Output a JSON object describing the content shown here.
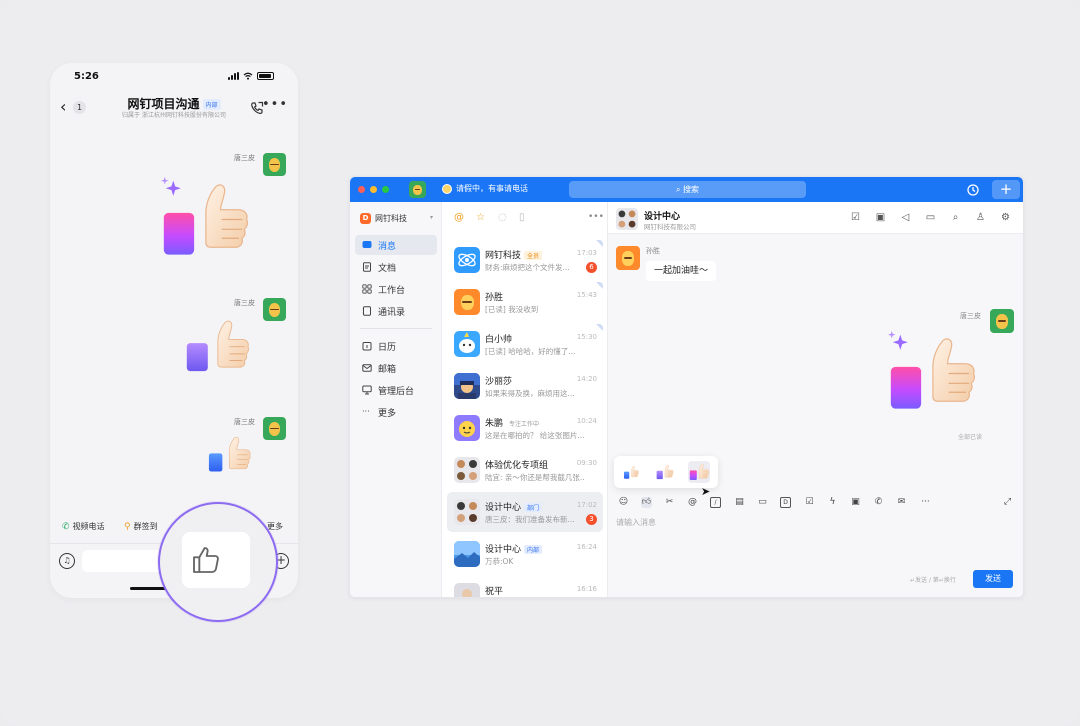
{
  "phone": {
    "time": "5:26",
    "title": "网钉项目沟通",
    "title_tag": "内部",
    "subtitle": "归属于 浙江杭州网钉科技股份有限公司",
    "back_count": "1",
    "messages": [
      {
        "sender": "唐三皮"
      },
      {
        "sender": "唐三皮"
      },
      {
        "sender": "唐三皮"
      }
    ],
    "quick_actions": [
      {
        "label": "视频电话"
      },
      {
        "label": "群签到"
      },
      {
        "label": "更多"
      }
    ]
  },
  "window": {
    "status_text": "请假中，有事请电话",
    "search_placeholder": "搜索",
    "org_name": "网钉科技",
    "org_logo_letter": "D",
    "nav": [
      {
        "label": "消息",
        "icon": "message-icon"
      },
      {
        "label": "文档",
        "icon": "document-icon"
      },
      {
        "label": "工作台",
        "icon": "grid-icon"
      },
      {
        "label": "通讯录",
        "icon": "contacts-icon"
      },
      {
        "label": "日历",
        "icon": "calendar-icon"
      },
      {
        "label": "邮箱",
        "icon": "mail-icon"
      },
      {
        "label": "管理后台",
        "icon": "admin-icon"
      },
      {
        "label": "更多",
        "icon": "more-icon"
      }
    ],
    "conversations": [
      {
        "name": "网钉科技",
        "tag": "全员",
        "preview": "财务:麻烦把这个文件发...",
        "time": "17:03",
        "badge": "6"
      },
      {
        "name": "孙胜",
        "tag": "",
        "preview": "[已读] 我没收到",
        "time": "15:43",
        "badge": ""
      },
      {
        "name": "白小帅",
        "tag": "",
        "preview": "[已读] 哈哈哈，好的懂了...",
        "time": "15:30",
        "badge": ""
      },
      {
        "name": "沙丽莎",
        "tag": "",
        "preview": "如果来得及换，麻烦用这...",
        "time": "14:20",
        "badge": ""
      },
      {
        "name": "朱鹏",
        "tag": "专注工作中",
        "preview": "这是在哪拍的？ 给这张图片...",
        "time": "10:24",
        "badge": ""
      },
      {
        "name": "体验优化专项组",
        "tag": "",
        "preview": "陆宜: 亲～你还是帮我截几张...",
        "time": "09:30",
        "badge": ""
      },
      {
        "name": "设计中心",
        "tag": "部门",
        "preview": "唐三皮：我们准备发布新...",
        "time": "17:02",
        "badge": "3"
      },
      {
        "name": "设计中心",
        "tag": "内部",
        "preview": "万恭:OK",
        "time": "16:24",
        "badge": ""
      },
      {
        "name": "祝平",
        "tag": "",
        "preview": "",
        "time": "16:16",
        "badge": ""
      }
    ],
    "chat": {
      "title": "设计中心",
      "subtitle": "网钉科技有限公司",
      "incoming_sender": "孙胜",
      "incoming_text": "一起加油哇～",
      "outgoing_sender": "唐三皮",
      "read_status": "全部已读",
      "input_placeholder": "请输入消息",
      "send_hint": "↵发送 / 第↵换行",
      "send_label": "发送"
    }
  },
  "colors": {
    "brand_blue": "#1a76f5",
    "badge_red": "#f4502c",
    "accent_purple": "#8d6bf0"
  }
}
